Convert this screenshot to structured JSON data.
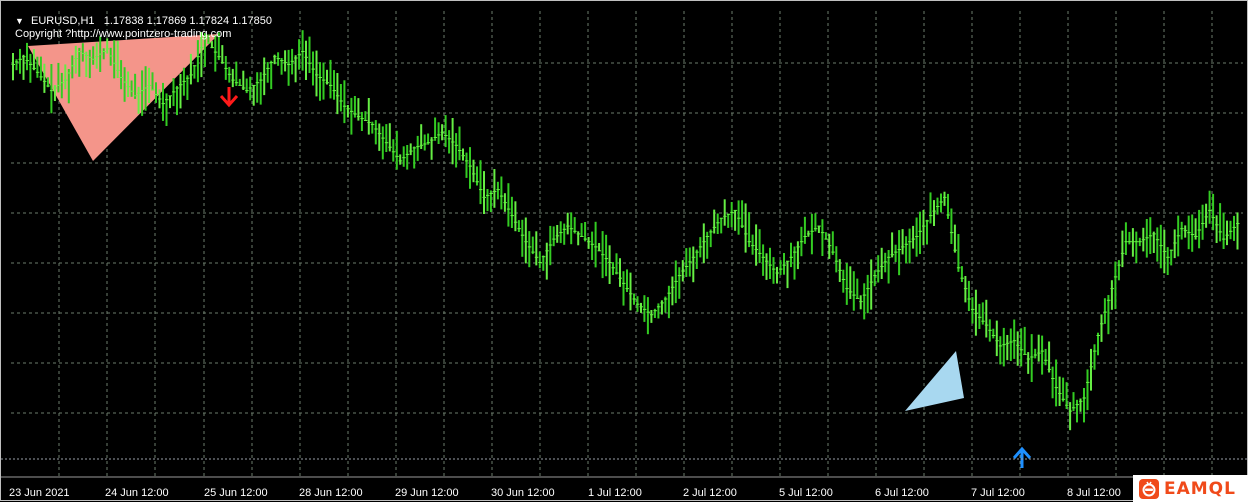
{
  "header": {
    "symbol": "EURUSD,H1",
    "open": "1.17838",
    "high": "1.17869",
    "low": "1.17824",
    "close": "1.17850",
    "copyright": "Copyright ?http://www.pointzero-trading.com"
  },
  "xaxis": {
    "labels": [
      "23 Jun 2021",
      "24 Jun 12:00",
      "25 Jun 12:00",
      "28 Jun 12:00",
      "29 Jun 12:00",
      "30 Jun 12:00",
      "1 Jul 12:00",
      "2 Jul 12:00",
      "5 Jul 12:00",
      "6 Jul 12:00",
      "7 Jul 12:00",
      "8 Jul 12:00"
    ]
  },
  "logo": {
    "text": "EAMQL"
  },
  "colors": {
    "background": "#000000",
    "grid": "#6b7b6b",
    "bars": "#33cc22",
    "bars_light": "#66ee44",
    "sell_triangle": "#f4958a",
    "buy_triangle": "#a8d8f0",
    "sell_arrow": "#ff1a1a",
    "buy_arrow": "#1e90ff",
    "logo": "#f04a1a"
  },
  "chart_data": {
    "type": "line",
    "series": [
      {
        "values": [
          1.1935,
          1.1939,
          1.1933,
          1.1926,
          1.193,
          1.1941,
          1.1938,
          1.1942,
          1.1931,
          1.1924,
          1.1928,
          1.1921,
          1.1927,
          1.1932,
          1.1946,
          1.1939,
          1.193,
          1.1926,
          1.193,
          1.1939,
          1.1936,
          1.1941,
          1.1932,
          1.1928,
          1.192,
          1.1916,
          1.1913,
          1.1906,
          1.1899,
          1.1904,
          1.1906,
          1.191,
          1.1905,
          1.1897,
          1.1885,
          1.1888,
          1.1878,
          1.1868,
          1.186,
          1.1869,
          1.1874,
          1.187,
          1.1866,
          1.186,
          1.1852,
          1.1844,
          1.184,
          1.1846,
          1.1855,
          1.1862,
          1.187,
          1.1877,
          1.188,
          1.1868,
          1.1862,
          1.1856,
          1.1862,
          1.187,
          1.1874,
          1.1864,
          1.185,
          1.1845,
          1.1855,
          1.1862,
          1.1866,
          1.187,
          1.1878,
          1.1885,
          1.1858,
          1.1842,
          1.1836,
          1.1828,
          1.183,
          1.1823,
          1.1826,
          1.1812,
          1.1803,
          1.1808,
          1.1832,
          1.185,
          1.1868,
          1.1868,
          1.1871,
          1.1862,
          1.1873,
          1.187,
          1.188,
          1.1869,
          1.1875
        ]
      }
    ],
    "ylim": [
      1.178,
      1.1955
    ],
    "grid": true,
    "annotations": [
      "sell triangle 23-25 Jun",
      "sell arrow 25 Jun",
      "buy triangle 6 Jul",
      "buy arrow 7 Jul 12:00"
    ]
  }
}
